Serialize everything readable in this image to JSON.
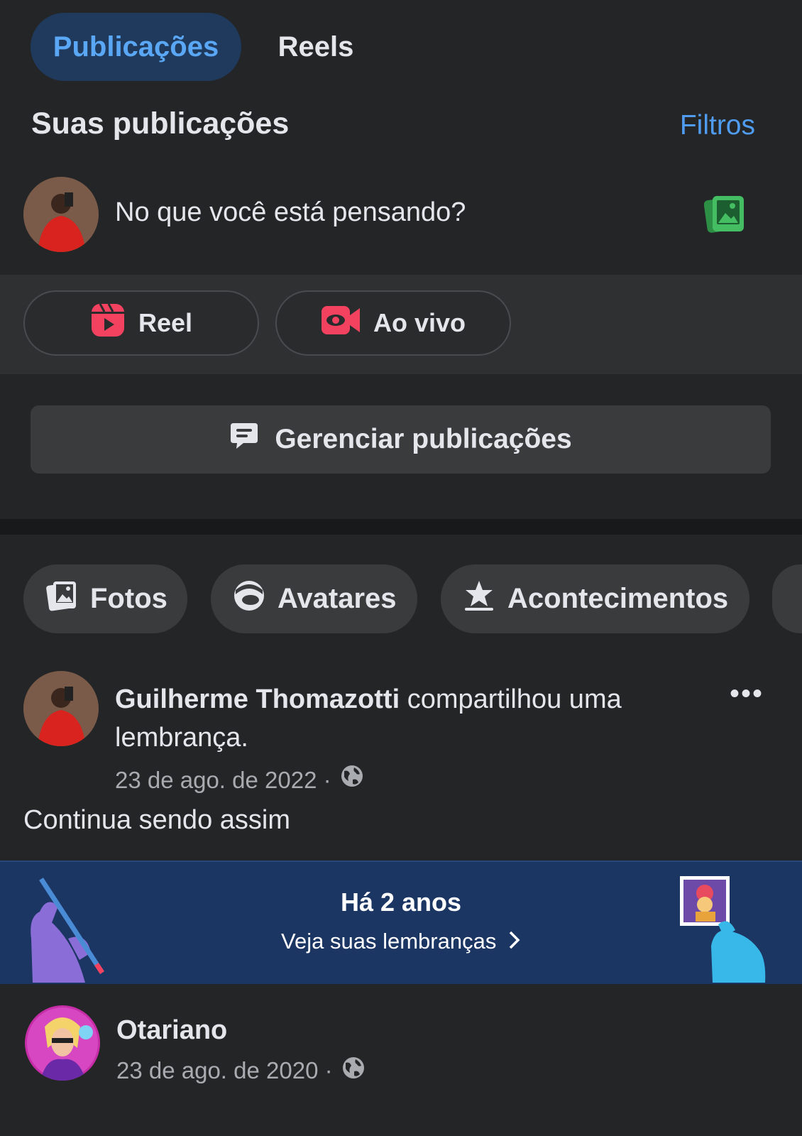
{
  "tabs": {
    "posts": "Publicações",
    "reels": "Reels"
  },
  "section": {
    "title": "Suas publicações",
    "filters": "Filtros"
  },
  "composer": {
    "placeholder": "No que você está pensando?"
  },
  "create_actions": {
    "reel": "Reel",
    "live": "Ao vivo"
  },
  "manage_posts": "Gerenciar publicações",
  "chips": {
    "photos": "Fotos",
    "avatars": "Avatares",
    "events": "Acontecimentos"
  },
  "post1": {
    "author": "Guilherme Thomazotti",
    "action": " compartilhou uma lembrança.",
    "date": "23 de ago. de 2022 ·",
    "text": "Continua sendo assim"
  },
  "memory": {
    "title": "Há 2 anos",
    "link": "Veja suas lembranças"
  },
  "post2": {
    "author": "Otariano",
    "date": "23 de ago. de 2020 ·"
  },
  "colors": {
    "accent_blue": "#4f9cf0",
    "reel_red": "#f3425f",
    "photo_green": "#45bd62",
    "memory_bg": "#1c3663"
  }
}
